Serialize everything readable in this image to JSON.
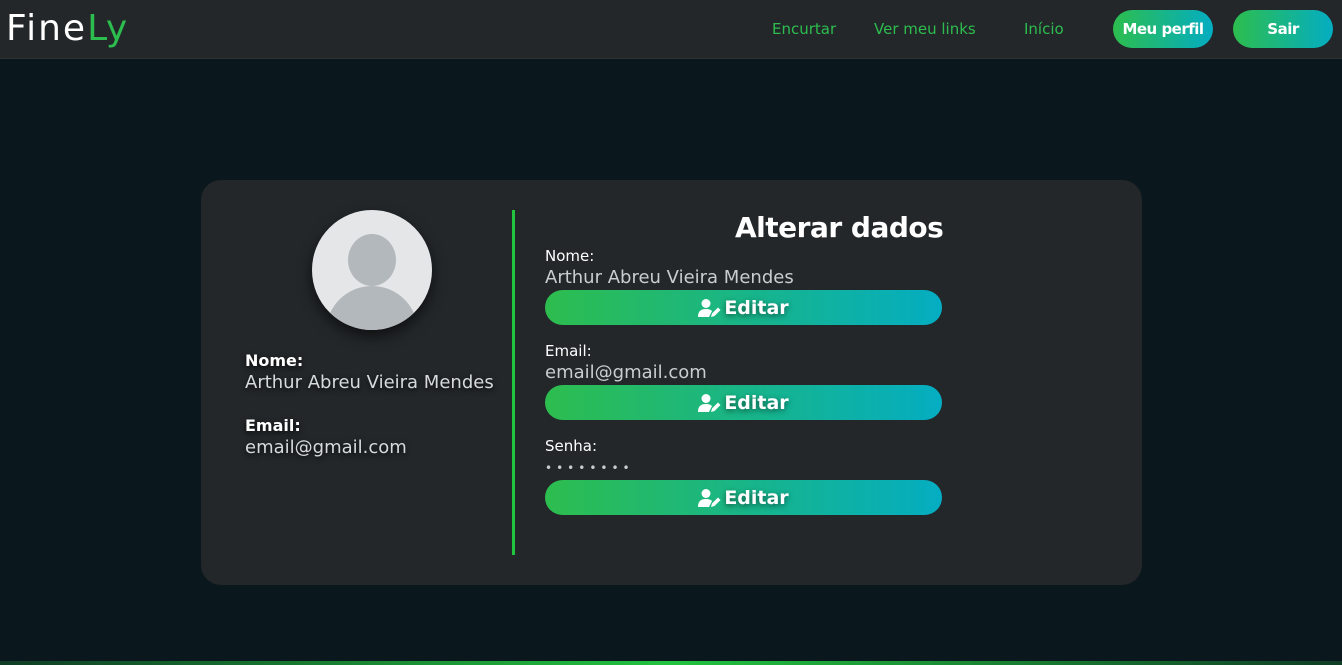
{
  "app": {
    "logo_main": "Fine",
    "logo_accent": "Ly"
  },
  "nav": {
    "shorten": "Encurtar",
    "my_links": "Ver meu links",
    "home": "Início",
    "profile": "Meu perfil",
    "logout": "Sair"
  },
  "profile": {
    "name_label": "Nome:",
    "name_value": "Arthur Abreu Vieira Mendes",
    "email_label": "Email:",
    "email_value": "email@gmail.com"
  },
  "edit": {
    "title": "Alterar dados",
    "fields": [
      {
        "label": "Nome:",
        "value": "Arthur Abreu Vieira Mendes",
        "button": "Editar"
      },
      {
        "label": "Email:",
        "value": "email@gmail.com",
        "button": "Editar"
      },
      {
        "label": "Senha:",
        "value": "••••••••",
        "button": "Editar"
      }
    ]
  },
  "icons": {
    "avatar": "user-avatar-icon",
    "edit": "user-edit-icon"
  },
  "colors": {
    "accent": "#2dbd4e",
    "gradient_end": "#04adc2",
    "background": "#0a181d",
    "panel": "#23272a"
  }
}
